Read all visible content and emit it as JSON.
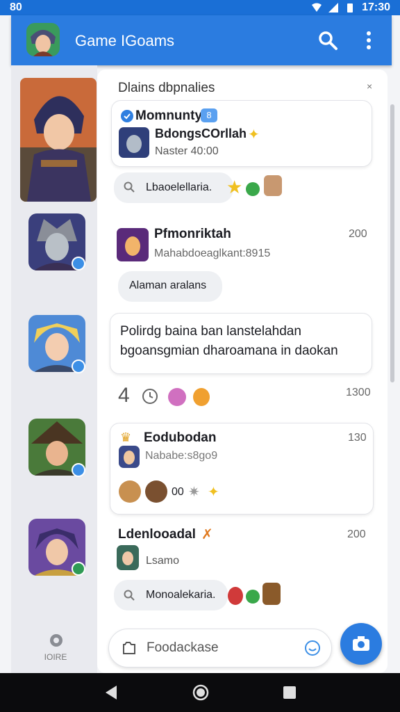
{
  "status_bar": {
    "left_text": "80",
    "time": "17:30"
  },
  "app_bar": {
    "title": "Game IGoams"
  },
  "sidebar": {
    "footer_label": "IOIRE"
  },
  "chat": {
    "header_title": "Dlains dbpnalies",
    "card1": {
      "group": "Momnuntyh",
      "group_badge": "8",
      "name": "BdongsCOrllah",
      "meta": "Naster 40:00"
    },
    "search1": {
      "label": "Lbaoelellaria."
    },
    "msg2": {
      "name": "Pfmonriktah",
      "time": "200",
      "subtitle": "Mahabdoeaglkant:8915",
      "pill": "Alaman aralans"
    },
    "card3": {
      "line1": "Polirdg baina ban lanstelahdan",
      "line2": "bgoansgmian dharoamana in daokan"
    },
    "reactions": {
      "count": "4",
      "time": "1300"
    },
    "card4": {
      "name": "Eodubodan",
      "time": "130",
      "subtitle": "Nababe:s8go9",
      "count": "00"
    },
    "msg5": {
      "name": "Ldenlooadal",
      "time": "200",
      "subtitle": "Lsamo"
    },
    "search2": {
      "label": "Monoalekaria."
    }
  },
  "composer": {
    "placeholder": "Foodackase"
  },
  "colors": {
    "primary": "#2b7ce0",
    "status_bar": "#1a6fd6",
    "badge": "#3c8fe6"
  }
}
